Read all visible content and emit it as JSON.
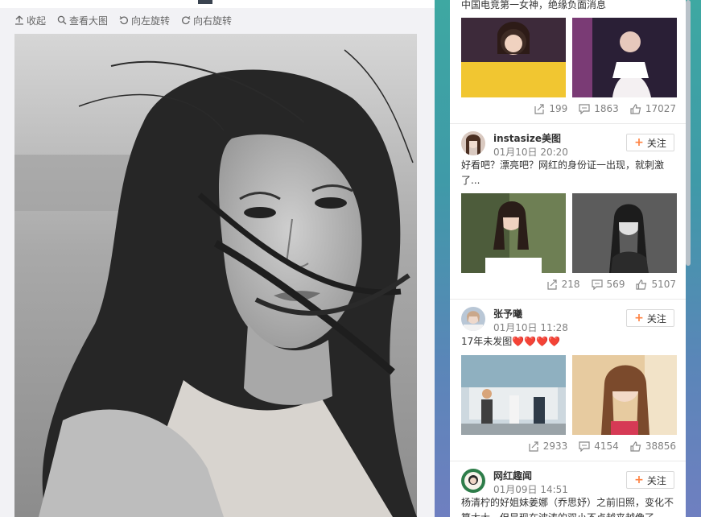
{
  "viewer": {
    "toolbar": {
      "collapse_label": "收起",
      "view_large_label": "查看大图",
      "rotate_left_label": "向左旋转",
      "rotate_right_label": "向右旋转"
    }
  },
  "feed": {
    "cards": [
      {
        "text": "中国电竞第一女神，绝缘负面消息",
        "reposts": "199",
        "comments": "1863",
        "likes": "17027"
      },
      {
        "username": "instasize美图",
        "time": "01月10日 20:20",
        "follow_label": "关注",
        "text": "好看吧？漂亮吧？网红的身份证一出现，就刺激了...",
        "reposts": "218",
        "comments": "569",
        "likes": "5107"
      },
      {
        "username": "张予曦",
        "time": "01月10日 11:28",
        "follow_label": "关注",
        "text": "17年未发图❤️❤️❤️❤️",
        "reposts": "2933",
        "comments": "4154",
        "likes": "38856"
      },
      {
        "username": "网红趣闻",
        "time": "01月09日 14:51",
        "follow_label": "关注",
        "text": "杨清柠的好姐妹姜娜（乔思妤）之前旧照，变化不算太大，但是现在波涛的双小不点越来越像了..."
      }
    ]
  },
  "colors": {
    "accent_orange": "#ff8140",
    "muted_text": "#808080",
    "feed_background": "#3f9aa8"
  }
}
